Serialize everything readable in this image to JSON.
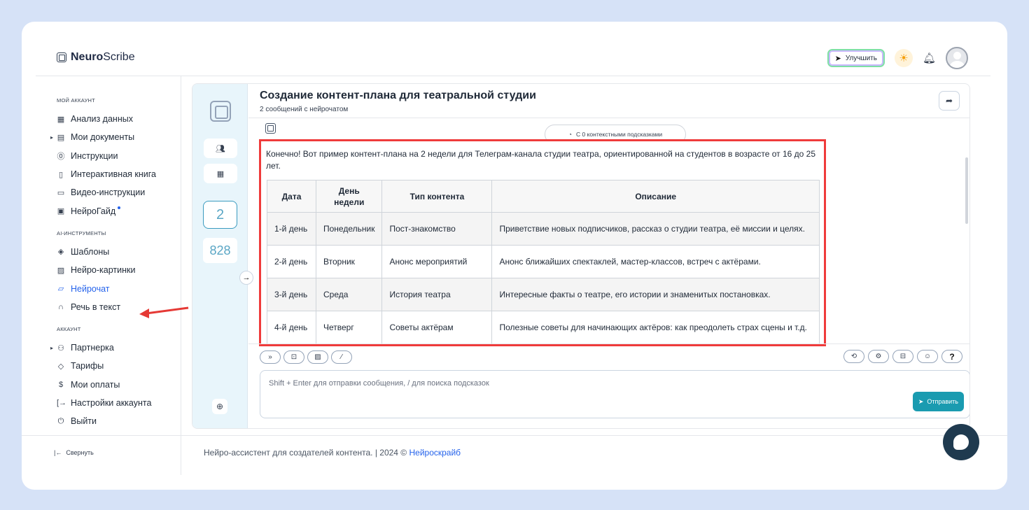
{
  "app": {
    "logo_bold": "Neuro",
    "logo_rest": "Scribe"
  },
  "header": {
    "upgrade_label": "Улучшить"
  },
  "sidebar": {
    "section_account": "Мой аккаунт",
    "account_items": [
      {
        "label": "Анализ данных",
        "icon": "grid-icon"
      },
      {
        "label": "Мои документы",
        "icon": "document-icon"
      },
      {
        "label": "Инструкции",
        "icon": "help-circle-icon"
      },
      {
        "label": "Интерактивная книга",
        "icon": "book-icon"
      },
      {
        "label": "Видео-инструкции",
        "icon": "video-icon"
      },
      {
        "label": "НейроГайд",
        "icon": "guide-icon"
      }
    ],
    "section_ai": "AI-инструменты",
    "ai_items": [
      {
        "label": "Шаблоны",
        "icon": "layers-icon"
      },
      {
        "label": "Нейро-картинки",
        "icon": "image-icon"
      },
      {
        "label": "Нейрочат",
        "icon": "chat-icon"
      },
      {
        "label": "Речь в текст",
        "icon": "headphones-icon"
      }
    ],
    "section_acc2": "Аккаунт",
    "acc2_items": [
      {
        "label": "Партнерка",
        "icon": "users-icon"
      },
      {
        "label": "Тарифы",
        "icon": "tag-icon"
      },
      {
        "label": "Мои оплаты",
        "icon": "dollar-icon"
      },
      {
        "label": "Настройки аккаунта",
        "icon": "settings-icon"
      },
      {
        "label": "Выйти",
        "icon": "power-icon"
      }
    ],
    "collapse_label": "Свернуть"
  },
  "chat": {
    "title": "Создание контент-плана для театральной студии",
    "subtitle": "2 сообщений с нейрочатом",
    "rail_count": "2",
    "rail_count2": "828",
    "context_pill": "С 0 контекстными подсказками",
    "message_text": "Конечно! Вот пример контент-плана на 2 недели для Телеграм-канала студии театра, ориентированной на студентов в возрасте от 16 до 25 лет.",
    "table_headers": [
      "Дата",
      "День недели",
      "Тип контента",
      "Описание"
    ],
    "table_rows": [
      [
        "1-й день",
        "Понедельник",
        "Пост-знакомство",
        "Приветствие новых подписчиков, рассказ о студии театра, её миссии и целях."
      ],
      [
        "2-й день",
        "Вторник",
        "Анонс мероприятий",
        "Анонс ближайших спектаклей, мастер-классов, встреч с актёрами."
      ],
      [
        "3-й день",
        "Среда",
        "История театра",
        "Интересные факты о театре, его истории и знаменитых постановках."
      ],
      [
        "4-й день",
        "Четверг",
        "Советы актёрам",
        "Полезные советы для начинающих актёров: как преодолеть страх сцены и т.д."
      ]
    ],
    "input_placeholder": "Shift + Enter для отправки сообщения, / для поиска подсказок",
    "send_label": "Отправить",
    "help_label": "?"
  },
  "footer": {
    "text": "Нейро-ассистент для создателей контента.  | 2024 © ",
    "link": "Нейроскрайб"
  },
  "colors": {
    "accent": "#2563eb",
    "send": "#1a9bb0",
    "highlight": "#ef3b3b",
    "rail": "#e8f5fb"
  }
}
